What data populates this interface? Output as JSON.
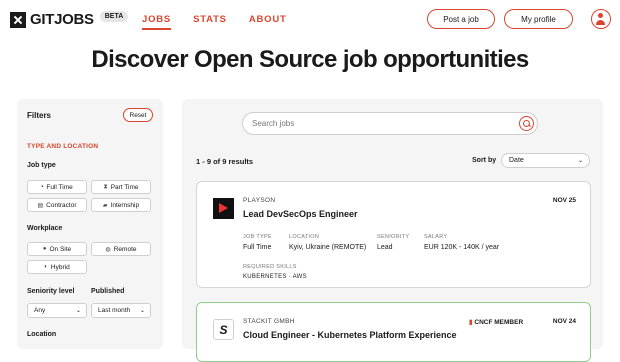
{
  "header": {
    "logo_text": "GITJOBS",
    "badge": "BETA",
    "nav": [
      "JOBS",
      "STATS",
      "ABOUT"
    ],
    "post_job": "Post a job",
    "my_profile": "My profile"
  },
  "hero": {
    "title": "Discover Open Source job opportunities"
  },
  "filters": {
    "title": "Filters",
    "reset": "Reset",
    "section_type_location": "TYPE AND LOCATION",
    "job_type_label": "Job type",
    "job_types": [
      "Full Time",
      "Part Time",
      "Contractor",
      "Internship"
    ],
    "workplace_label": "Workplace",
    "workplaces": [
      "On Site",
      "Remote",
      "Hybrid"
    ],
    "seniority_label": "Seniority level",
    "seniority_value": "Any",
    "published_label": "Published",
    "published_value": "Last month",
    "location_label": "Location"
  },
  "main": {
    "search_placeholder": "Search jobs",
    "results_text": "1 - 9 of 9 results",
    "sort_label": "Sort by",
    "sort_value": "Date"
  },
  "jobs": [
    {
      "company": "PLAYSON",
      "title": "Lead DevSecOps Engineer",
      "date": "NOV 25",
      "job_type_label": "JOB TYPE",
      "job_type": "Full Time",
      "location_label": "LOCATION",
      "location": "Kyiv, Ukraine (REMOTE)",
      "seniority_label": "SENIORITY",
      "seniority": "Lead",
      "salary_label": "SALARY",
      "salary": "EUR 120K - 140K  / year",
      "skills_label": "REQUIRED SKILLS",
      "skills": "KUBERNETES · AWS"
    },
    {
      "company": "STACKIT GMBH",
      "title": "Cloud Engineer - Kubernetes Platform Experience",
      "date": "NOV 24",
      "badge": "CNCF MEMBER",
      "logo_glyph": "S"
    }
  ]
}
